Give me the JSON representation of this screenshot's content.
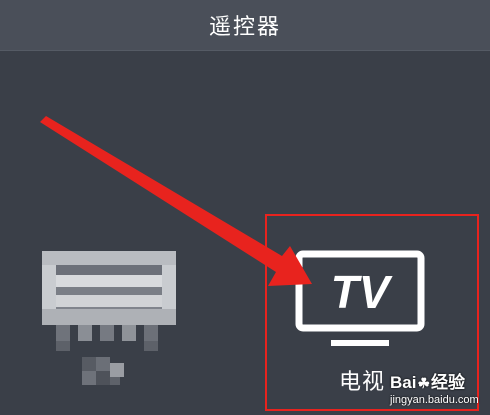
{
  "header": {
    "title": "遥控器"
  },
  "devices": [
    {
      "label": "",
      "icon": "air-conditioner-icon"
    },
    {
      "label": "电视",
      "icon": "tv-icon",
      "icon_text": "TV",
      "highlighted": true
    }
  ],
  "annotation": {
    "arrow_color": "#e8231e",
    "highlight_color": "#e8231e"
  },
  "watermark": {
    "brand_left": "Bai",
    "brand_right": "经验",
    "domain": "jingyan.baidu.com"
  },
  "colors": {
    "background": "#3a3f48",
    "header": "#4a4f59",
    "text": "#ffffff"
  }
}
